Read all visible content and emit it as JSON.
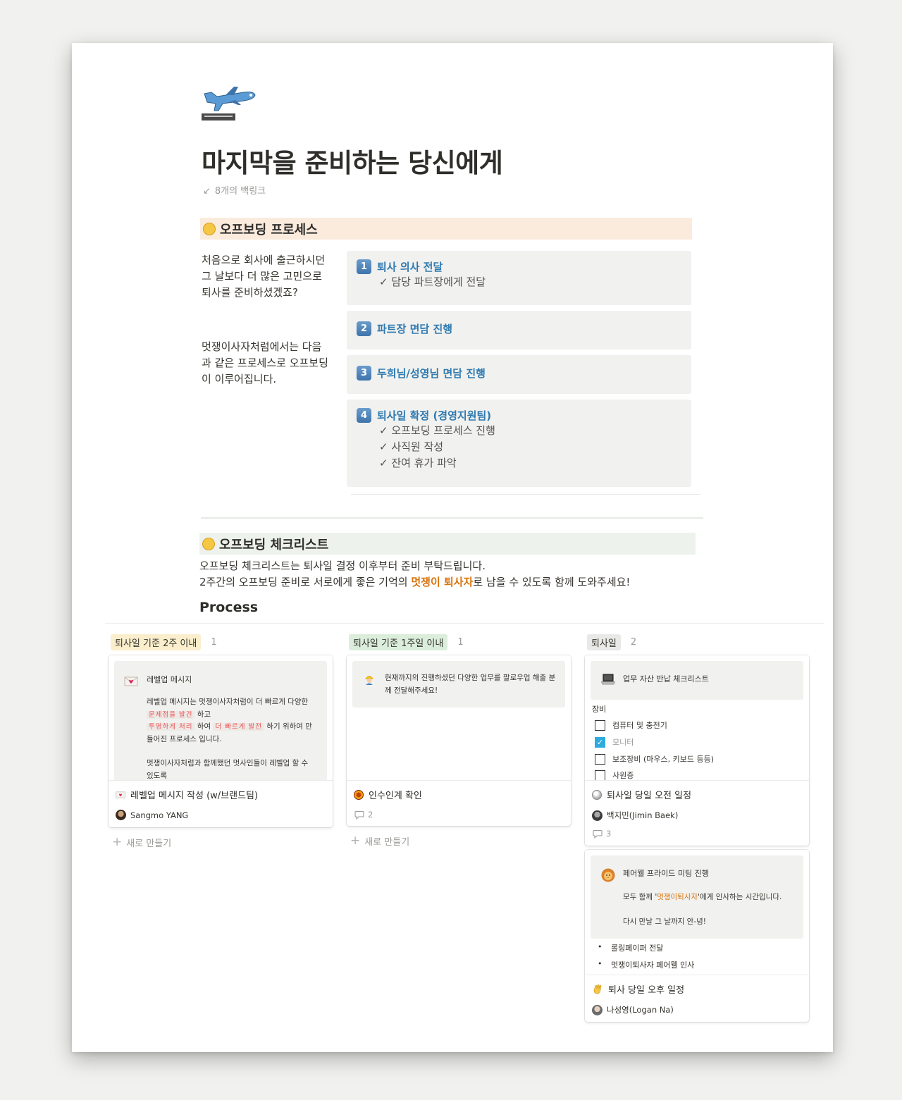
{
  "page": {
    "title": "마지막을 준비하는 당신에게",
    "backlinks": "8개의 백링크"
  },
  "offboarding_process": {
    "heading": "오프보딩 프로세스",
    "intro_1": "처음으로 회사에 출근하시던 그 날보다 더 많은 고민으로 퇴사를 준비하셨겠죠?",
    "intro_2": "멋쟁이사자처럼에서는 다음과 같은 프로세스로 오프보딩이 이루어집니다.",
    "steps": [
      {
        "num": "1",
        "title": "퇴사 의사 전달",
        "items": [
          "✓ 담당 파트장에게 전달"
        ]
      },
      {
        "num": "2",
        "title": "파트장 면담 진행",
        "items": []
      },
      {
        "num": "3",
        "title": "두희님/성영님 면담 진행",
        "items": []
      },
      {
        "num": "4",
        "title": "퇴사일 확정 (경영지원팀)",
        "items": [
          "✓ 오프보딩 프로세스 진행",
          "✓ 사직원 작성",
          "✓ 잔여 휴가 파악"
        ]
      }
    ]
  },
  "checklist": {
    "heading": "오프보딩 체크리스트",
    "line1": "오프보딩 체크리스트는 퇴사일 결정 이후부터 준비 부탁드립니다.",
    "line2_before": "2주간의 오프보딩 준비로 서로에게 좋은 기억의 ",
    "line2_highlight": "멋쟁이 퇴사자",
    "line2_after": "로 남을 수 있도록 함께 도와주세요!",
    "process_title": "Process"
  },
  "board": {
    "new_label": "새로 만들기",
    "columns": [
      {
        "name": "퇴사일 기준 2주 이내",
        "count": "1",
        "tag_color": "#fbeecc",
        "cards": [
          {
            "preview_title": "레벨업 메시지",
            "preview_p1_a": "레벨업 메시지는 멋쟁이사자처럼이 더 빠르게 다양한 ",
            "code_1": "문제점을 발견",
            "preview_p1_b": " 하고",
            "code_2": "투명하게 처리",
            "preview_p1_c": " 하여 ",
            "code_3": "더 빠르게 발전",
            "preview_p1_d": " 하기 위하여 만들어진 프로세스 입니다.",
            "preview_p2": "멋쟁이사자처럼과 함께했던 멋사인들이 레벨업 할 수 있도록",
            "title": "레벨업 메시지 작성 (w/브랜드팀)",
            "person": "Sangmo YANG"
          }
        ]
      },
      {
        "name": "퇴사일 기준 1주일 이내",
        "count": "1",
        "tag_color": "#dbeddb",
        "cards": [
          {
            "preview_text": "현재까지의 진행하셨던 다양한 업무를 팔로우업 해줄 분께 전달해주세요!",
            "title": "인수인계 확인",
            "comments": "2"
          }
        ]
      },
      {
        "name": "퇴사일",
        "count": "2",
        "tag_color": "#e9e9e7",
        "cards": [
          {
            "preview_title": "업무 자산 반납 체크리스트",
            "section": "장비",
            "checklist": [
              {
                "label": "컴퓨터 및 충전기",
                "checked": false
              },
              {
                "label": "모니터",
                "checked": true
              },
              {
                "label": "보조장비 (마우스, 키보드 등등)",
                "checked": false
              },
              {
                "label": "사원증",
                "checked": false
              }
            ],
            "title": "퇴사일 당일 오전 일정",
            "person": "백지민(Jimin Baek)",
            "comments": "3"
          },
          {
            "preview_title": "페어웰 프라이드 미팅 진행",
            "p1_before": "모두 함께 '",
            "p1_highlight": "멋쟁이퇴사자",
            "p1_after": "'에게 인사하는 시간입니다.",
            "p2": "다시 만날 그 날까지 안-녕!",
            "bullets": [
              "롤링페이퍼 전달",
              "멋쟁이퇴사자 페어웰 인사"
            ],
            "title": "퇴사 당일 오후 일정",
            "person": "나성영(Logan Na)"
          }
        ]
      }
    ]
  },
  "colors": {
    "page_bg": "#f1f1ef",
    "process_heading_bg": "#faebdd",
    "checklist_heading_bg": "#edf3ec",
    "step_title": "#2f7ab0",
    "highlight_orange": "#d9730d",
    "checkbox_checked": "#2eaadc"
  },
  "icons": {
    "page_icon": "airplane-departure-icon",
    "process_heading": "disappointed-face-icon",
    "checklist_heading": "crying-face-icon"
  }
}
